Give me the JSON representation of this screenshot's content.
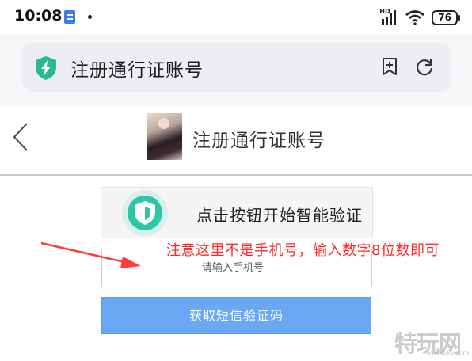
{
  "status_bar": {
    "time": "10:08",
    "signal_label": "HD",
    "battery": "76"
  },
  "browser": {
    "url_title": "注册通行证账号"
  },
  "header": {
    "title": "注册通行证账号"
  },
  "verify_button": {
    "label": "点击按钮开始智能验证"
  },
  "annotation": {
    "text": "注意这里不是手机号，输入数字8位数即可",
    "color": "#ff2a2a"
  },
  "phone_input": {
    "placeholder": "请输入手机号",
    "value": ""
  },
  "sms_button": {
    "label": "获取短信验证码",
    "color": "#6aa8f3"
  },
  "watermark": {
    "text": "特玩网",
    "url": "www.te5.com"
  },
  "icons": {
    "browser_shield": "shield-bolt-icon",
    "add_bookmark": "add-bookmark-icon",
    "refresh": "refresh-icon",
    "back": "chevron-left-icon",
    "verify": "shield-check-icon"
  }
}
